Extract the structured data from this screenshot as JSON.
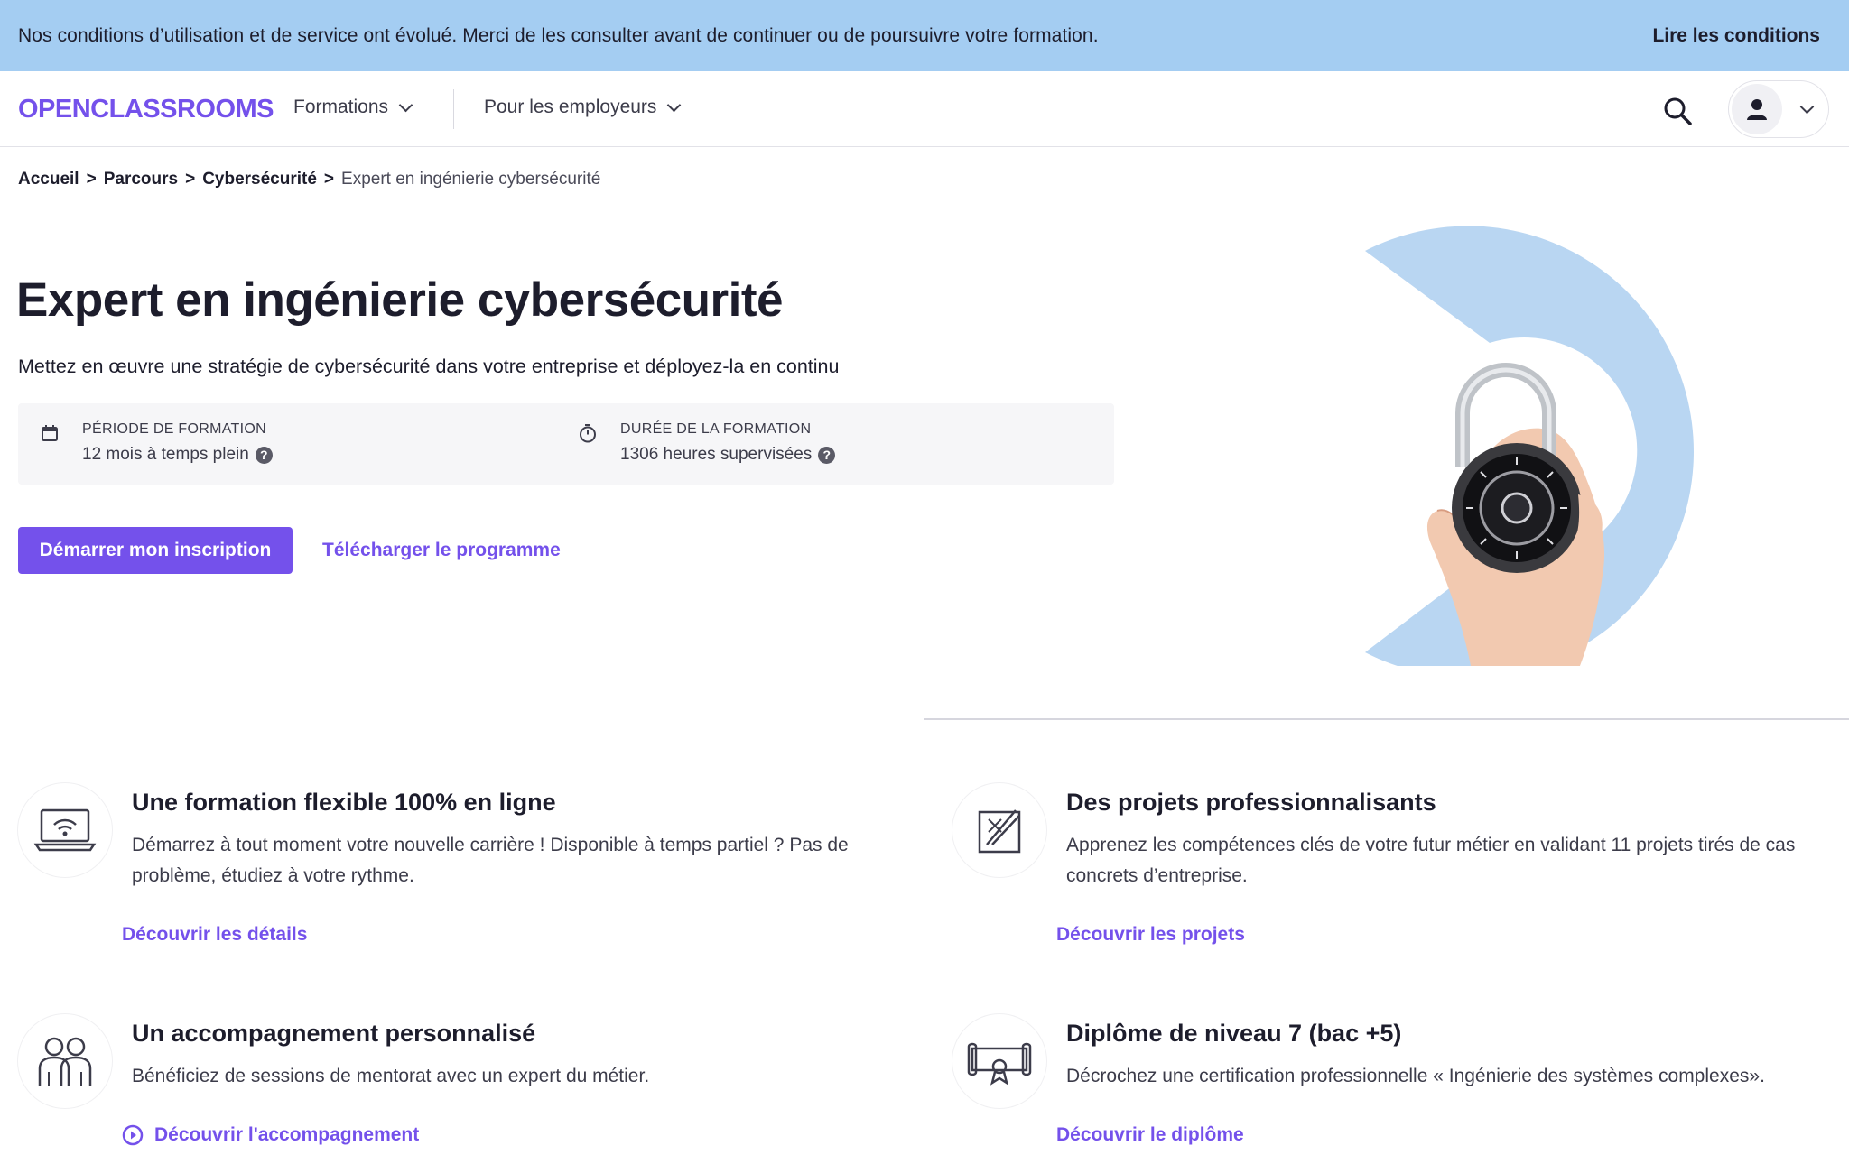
{
  "banner": {
    "text": "Nos conditions d’utilisation et de service ont évolué. Merci de les consulter avant de continuer ou de poursuivre votre formation.",
    "link": "Lire les conditions"
  },
  "header": {
    "logo": "OPENCLASSROOMS",
    "nav": {
      "formations": "Formations",
      "employers": "Pour les employeurs"
    }
  },
  "breadcrumb": {
    "items": [
      "Accueil",
      "Parcours",
      "Cybersécurité"
    ],
    "separator": ">",
    "current": "Expert en ingénierie cybersécurité"
  },
  "hero": {
    "title": "Expert en ingénierie cybersécurité",
    "subtitle": "Mettez en œuvre une stratégie de cybersécurité dans votre entreprise et déployez-la en continu",
    "period": {
      "label": "Période de formation",
      "value": "12 mois à temps plein"
    },
    "duration": {
      "label": "Durée de la formation",
      "value": "1306 heures supervisées"
    },
    "primary_button": "Démarrer mon inscription",
    "secondary_link": "Télécharger le programme"
  },
  "features": [
    {
      "title": "Une formation flexible 100% en ligne",
      "description": "Démarrez à tout moment votre nouvelle carrière ! Disponible à temps partiel ? Pas de problème, étudiez à votre rythme.",
      "link": "Découvrir les détails",
      "icon": "laptop-wifi-icon"
    },
    {
      "title": "Des projets professionnalisants",
      "description": "Apprenez les compétences clés de votre futur métier en validant 11 projets tirés de cas concrets d’entreprise.",
      "link": "Découvrir les projets",
      "icon": "blueprint-icon"
    },
    {
      "title": "Un accompagnement personnalisé",
      "description": "Bénéficiez de sessions de mentorat avec un expert du métier.",
      "link": "Découvrir l'accompagnement",
      "icon": "mentors-icon"
    },
    {
      "title": "Diplôme de niveau 7 (bac +5)",
      "description": "Décrochez une certification professionnelle « Ingénierie des systèmes complexes».",
      "link": "Découvrir le diplôme",
      "icon": "diploma-icon"
    }
  ],
  "colors": {
    "brand": "#7451eb",
    "banner_bg": "#a4cdf2",
    "hero_arc": "#b9d6f2",
    "text": "#1d1d2c"
  }
}
